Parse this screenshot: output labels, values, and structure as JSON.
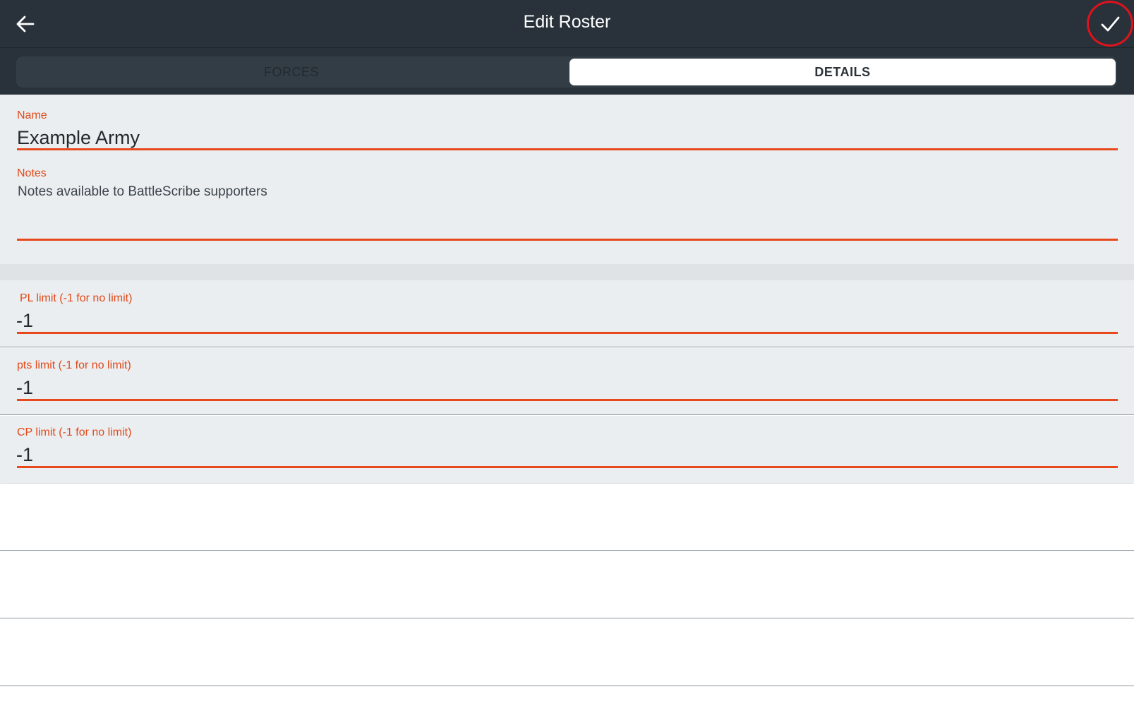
{
  "header": {
    "title": "Edit Roster",
    "back_icon": "arrow-left-icon",
    "confirm_icon": "checkmark-icon"
  },
  "tabs": [
    {
      "label": "FORCES",
      "selected": false
    },
    {
      "label": "DETAILS",
      "selected": true
    }
  ],
  "details": {
    "name_label": "Name",
    "name_value": "Example Army",
    "notes_label": "Notes",
    "notes_value": "Notes available to BattleScribe supporters"
  },
  "limits": [
    {
      "label": "PL limit (-1 for no limit)",
      "value": "-1"
    },
    {
      "label": "pts limit (-1 for no limit)",
      "value": "-1"
    },
    {
      "label": "CP limit (-1 for no limit)",
      "value": "-1"
    }
  ],
  "colors": {
    "header_bg": "#29323a",
    "accent": "#e8491c",
    "field_bg": "#ebeef1",
    "highlight_ring": "#e0121c"
  }
}
